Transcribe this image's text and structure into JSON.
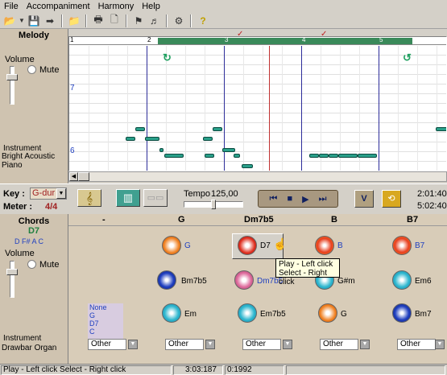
{
  "menu": [
    "File",
    "Accompaniment",
    "Harmony",
    "Help"
  ],
  "melody": {
    "title": "Melody",
    "volume_label": "Volume",
    "mute_label": "Mute",
    "instrument_label": "Instrument",
    "instrument_value": "Bright Acoustic Piano",
    "bar_numbers": [
      "1",
      "2",
      "3",
      "4",
      "5"
    ],
    "octave_labels": [
      "7",
      "6"
    ]
  },
  "key": {
    "label": "Key :",
    "value": "G-dur",
    "meter_label": "Meter :",
    "meter_value": "4/4"
  },
  "tempo": {
    "label": "Tempo",
    "value": "125,00"
  },
  "time": {
    "current": "2:01:400",
    "total": "5:02:400"
  },
  "chords": {
    "title": "Chords",
    "current": "D7",
    "notes": "D F# A C",
    "volume_label": "Volume",
    "mute_label": "Mute",
    "instrument_label": "Instrument",
    "instrument_value": "Drawbar Organ",
    "headers": [
      "-",
      "G",
      "Dm7b5",
      "B",
      "B7"
    ],
    "tooltip_line1": "Play - Left click",
    "tooltip_line2": "Select - Right click",
    "list": [
      "None",
      "G",
      "D7",
      "C"
    ],
    "row1": [
      "G",
      "D7",
      "B",
      "B7"
    ],
    "row2": [
      "Bm7b5",
      "Dm7b5",
      "G#m",
      "Em6"
    ],
    "row3": [
      "Em",
      "Em7b5",
      "G",
      "Bm7"
    ],
    "other": "Other",
    "colors": {
      "orange": "#f08020",
      "red": "#e03020",
      "blue": "#2040c0",
      "cyan": "#30b8d0",
      "pink": "#e070a0"
    }
  },
  "status": {
    "hint": "Play - Left click   Select - Right click",
    "time": "3:03:187",
    "pos": "0:1992"
  }
}
